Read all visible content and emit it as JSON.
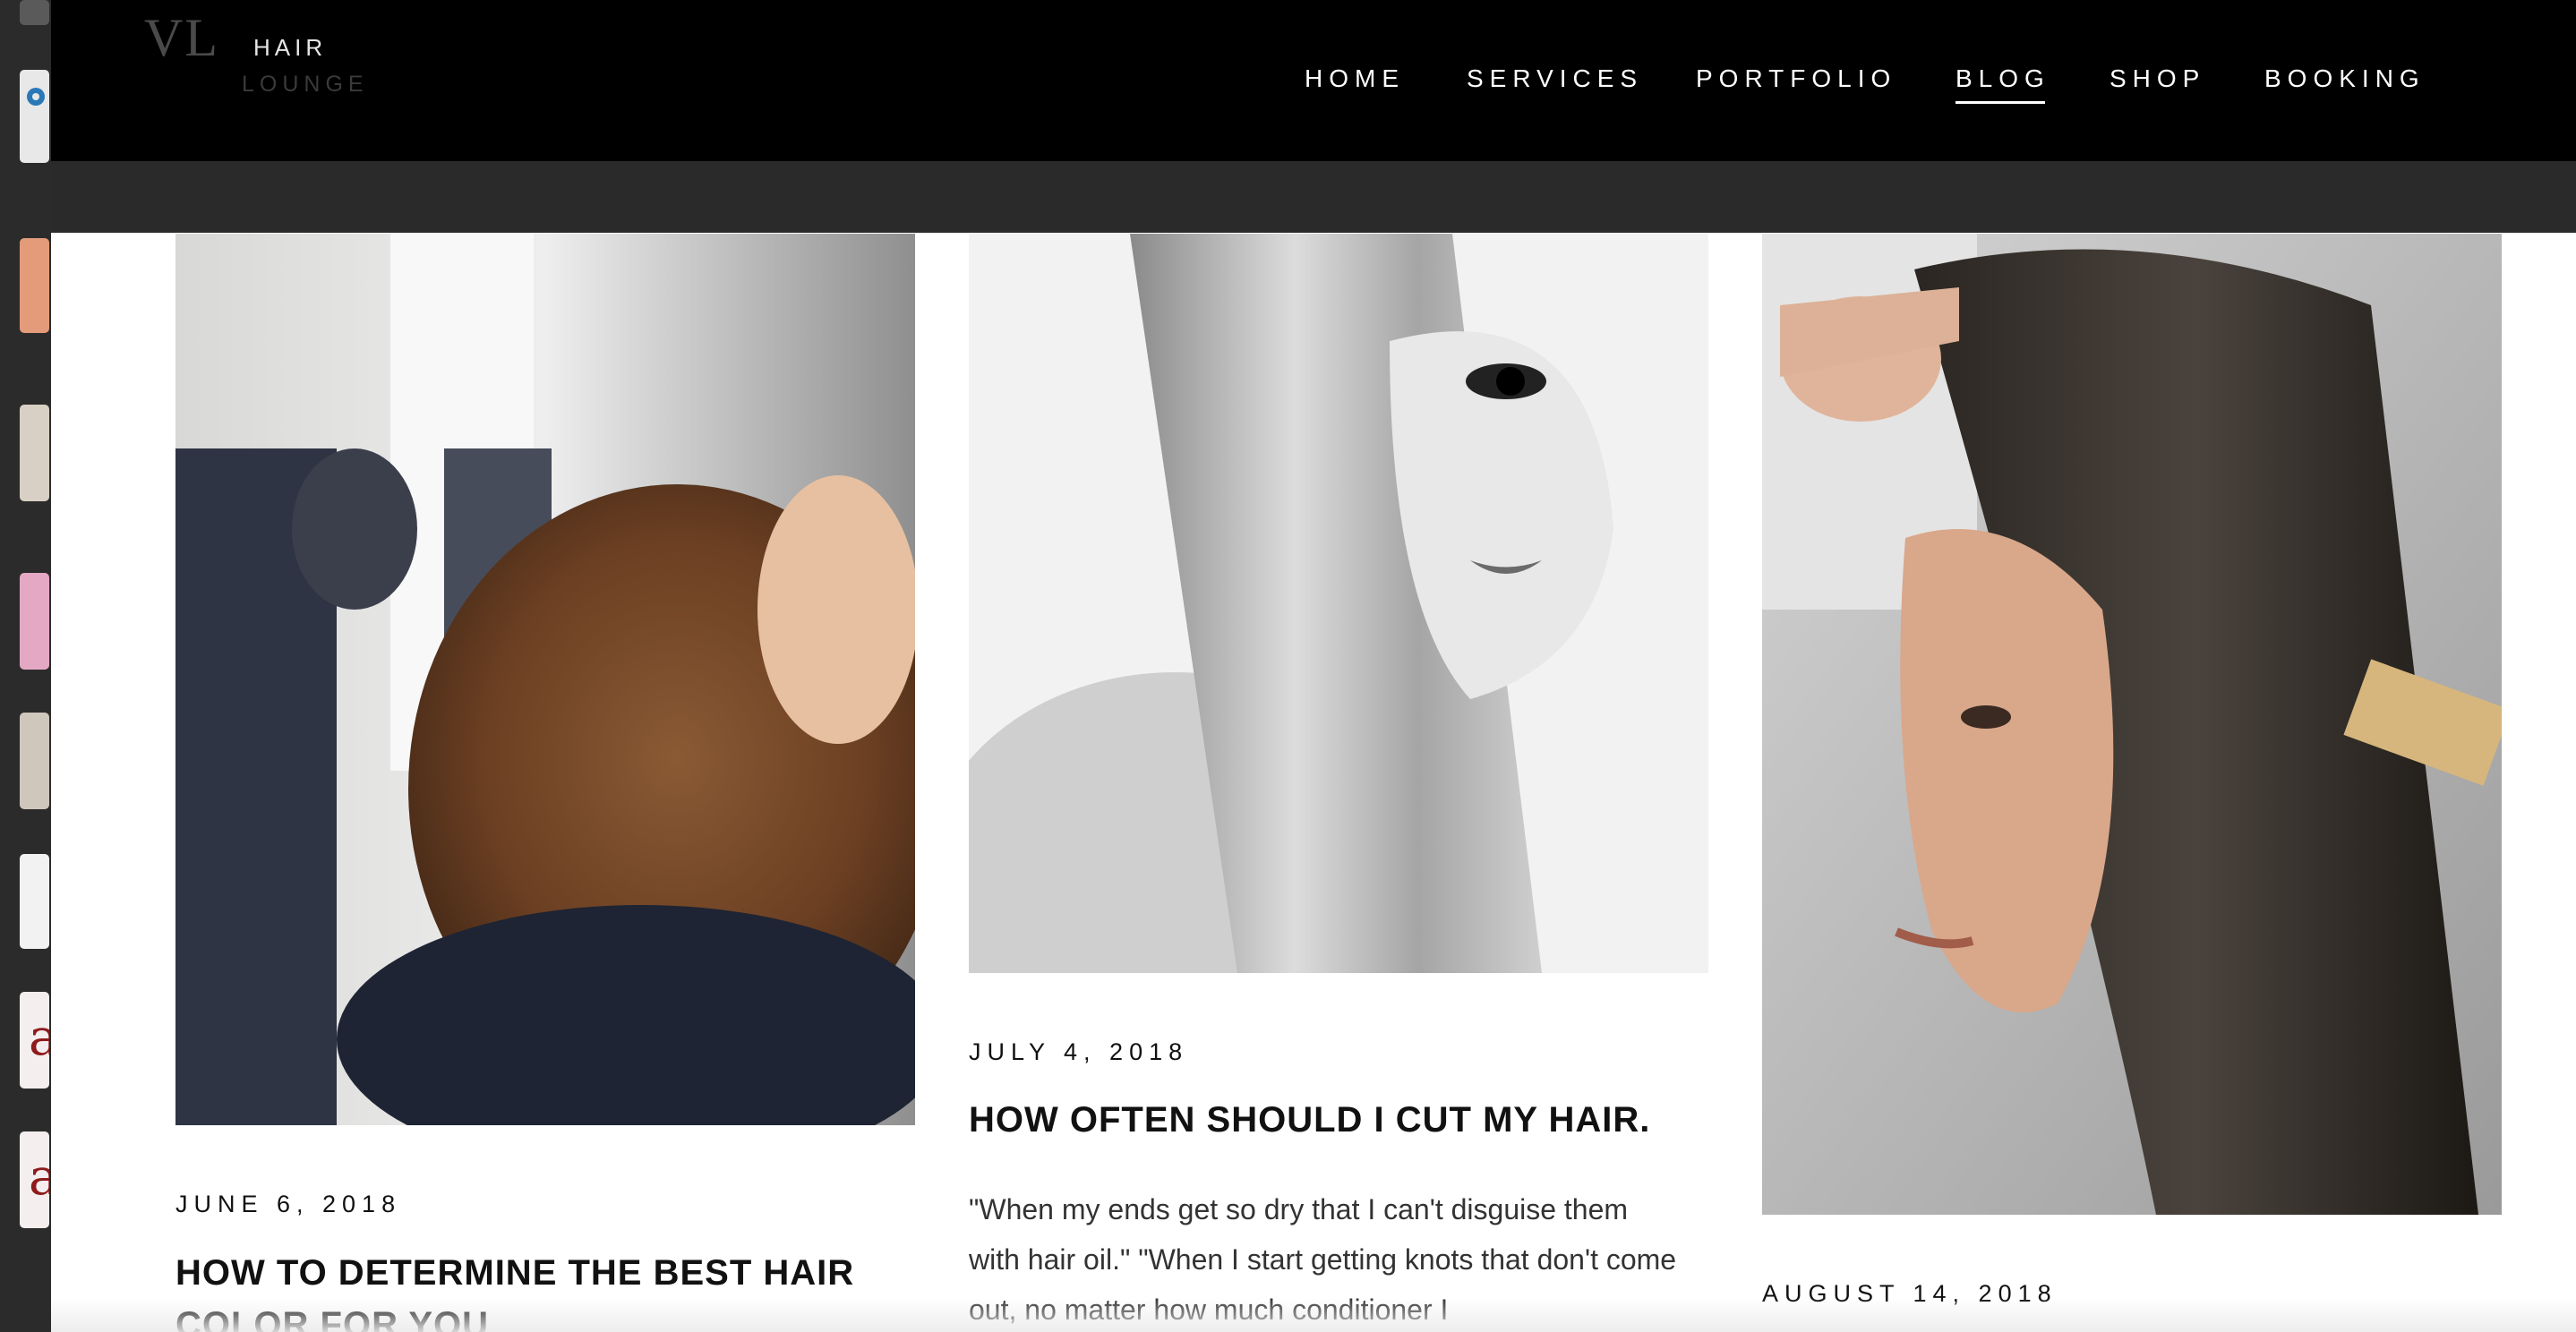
{
  "logo": {
    "mark": "VL",
    "line1": "HAIR",
    "line2": "LOUNGE"
  },
  "nav": {
    "home": "HOME",
    "services": "SERVICES",
    "portfolio": "PORTFOLIO",
    "blog": "BLOG",
    "shop": "SHOP",
    "booking": "BOOKING"
  },
  "posts": [
    {
      "date": "JUNE 6, 2018",
      "title": "HOW TO DETERMINE THE BEST HAIR COLOR FOR YOU"
    },
    {
      "date": "JULY 4, 2018",
      "title": "HOW OFTEN SHOULD I CUT MY HAIR.",
      "excerpt": "\"When my ends get so dry that I can't disguise them with hair oil.\" \"When I start getting knots that don't come out, no matter how much conditioner I"
    },
    {
      "date": "AUGUST 14, 2018"
    }
  ],
  "colors": {
    "header_bg": "#000000",
    "subbar_bg": "#2a2a2a",
    "text": "#111111",
    "nav_text": "#ffffff"
  }
}
